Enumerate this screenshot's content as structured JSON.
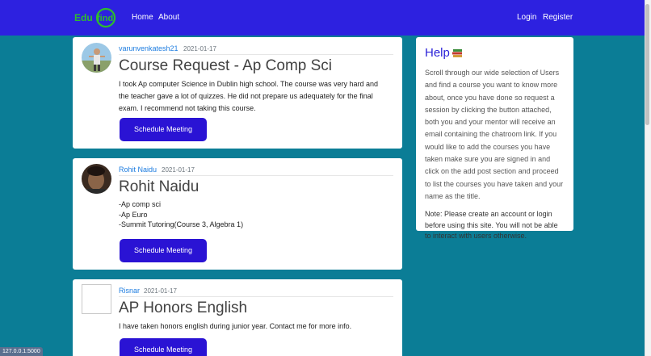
{
  "navbar": {
    "brand": "Edufind",
    "links": [
      "Home",
      "About"
    ],
    "auth": [
      "Login",
      "Register"
    ]
  },
  "posts": [
    {
      "author": "varunvenkatesh21",
      "date": "2021-01-17",
      "title": "Course Request - Ap Comp Sci",
      "body": [
        "I took Ap computer Science in Dublin high school. The course was very hard and the teacher gave a lot of quizzes. He did not prepare us adequately for the final exam. I recommend not taking this course."
      ],
      "button": "Schedule Meeting"
    },
    {
      "author": "Rohit Naidu",
      "date": "2021-01-17",
      "title": "Rohit Naidu",
      "body": [
        "-Ap comp sci",
        "-Ap Euro",
        "-Summit Tutoring(Course 3, Algebra 1)"
      ],
      "button": "Schedule Meeting"
    },
    {
      "author": "Risnar",
      "date": "2021-01-17",
      "title": "AP Honors English",
      "body": [
        "I have taken honors english during junior year. Contact me for more info."
      ],
      "button": "Schedule Meeting"
    }
  ],
  "help": {
    "title": "Help",
    "paragraph": "Scroll through our wide selection of Users and find a course you want to know more about, once you have done so request a session by clicking the button attached, both you and your mentor will receive an email containing the chatroom link. If you would like to add the courses you have taken make sure you are signed in and click on the add post section and proceed to list the courses you have taken and your name as the title.",
    "note": "Note: Please create an account or login before using this site. You will not be able to interact with users otherwise."
  },
  "statusbar": "127.0.0.1:5000",
  "colors": {
    "navbar": "#2d21e0",
    "page_bg": "#0b7d96",
    "button": "#2a13d4",
    "author_link": "#1e7de0",
    "brand_accent": "#2ebc2e"
  }
}
